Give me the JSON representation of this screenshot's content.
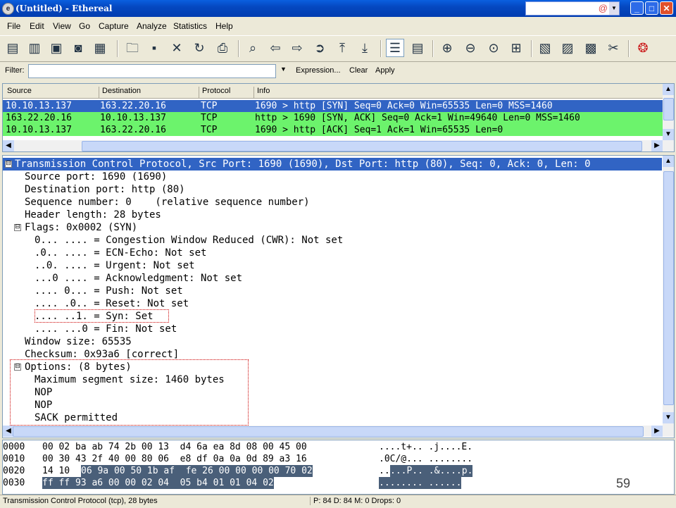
{
  "window": {
    "title": "(Untitled) - Ethereal"
  },
  "menu": [
    "File",
    "Edit",
    "View",
    "Go",
    "Capture",
    "Analyze",
    "Statistics",
    "Help"
  ],
  "filter": {
    "label": "Filter:",
    "value": "",
    "expression": "Expression...",
    "clear": "Clear",
    "apply": "Apply"
  },
  "packet_list": {
    "columns": [
      "Source",
      "Destination",
      "Protocol",
      "Info"
    ],
    "rows": [
      {
        "source": "10.10.13.137",
        "destination": "163.22.20.16",
        "protocol": "TCP",
        "info": "1690 > http [SYN] Seq=0 Ack=0 Win=65535 Len=0 MSS=1460",
        "selected": true
      },
      {
        "source": "163.22.20.16",
        "destination": "10.10.13.137",
        "protocol": "TCP",
        "info": "http > 1690 [SYN, ACK] Seq=0 Ack=1 Win=49640 Len=0 MSS=1460",
        "selected": false
      },
      {
        "source": "10.10.13.137",
        "destination": "163.22.20.16",
        "protocol": "TCP",
        "info": "1690 > http [ACK] Seq=1 Ack=1 Win=65535 Len=0",
        "selected": false
      }
    ]
  },
  "detail_tree": [
    {
      "text": "Transmission Control Protocol, Src Port: 1690 (1690), Dst Port: http (80), Seq: 0, Ack: 0, Len: 0",
      "depth": 0,
      "toggle": "⊟",
      "selected": true
    },
    {
      "text": "Source port: 1690 (1690)",
      "depth": 1
    },
    {
      "text": "Destination port: http (80)",
      "depth": 1
    },
    {
      "text": "Sequence number: 0    (relative sequence number)",
      "depth": 1
    },
    {
      "text": "Header length: 28 bytes",
      "depth": 1
    },
    {
      "text": "Flags: 0x0002 (SYN)",
      "depth": 1,
      "toggle": "⊟"
    },
    {
      "text": "0... .... = Congestion Window Reduced (CWR): Not set",
      "depth": 2
    },
    {
      "text": ".0.. .... = ECN-Echo: Not set",
      "depth": 2
    },
    {
      "text": "..0. .... = Urgent: Not set",
      "depth": 2
    },
    {
      "text": "...0 .... = Acknowledgment: Not set",
      "depth": 2
    },
    {
      "text": ".... 0... = Push: Not set",
      "depth": 2
    },
    {
      "text": ".... .0.. = Reset: Not set",
      "depth": 2
    },
    {
      "text": ".... ..1. = Syn: Set",
      "depth": 2
    },
    {
      "text": ".... ...0 = Fin: Not set",
      "depth": 2
    },
    {
      "text": "Window size: 65535",
      "depth": 1
    },
    {
      "text": "Checksum: 0x93a6 [correct]",
      "depth": 1
    },
    {
      "text": "Options: (8 bytes)",
      "depth": 1,
      "toggle": "⊟"
    },
    {
      "text": "Maximum segment size: 1460 bytes",
      "depth": 2
    },
    {
      "text": "NOP",
      "depth": 2
    },
    {
      "text": "NOP",
      "depth": 2
    },
    {
      "text": "SACK permitted",
      "depth": 2
    }
  ],
  "hex_dump": [
    {
      "offset": "0000",
      "bytes_plain": "00 02 ba ab 74 2b 00 13  d4 6a ea 8d 08 00 45 00",
      "bytes_hl": "",
      "ascii_plain": "....t+.. .j....E.",
      "ascii_hl": ""
    },
    {
      "offset": "0010",
      "bytes_plain": "00 30 43 2f 40 00 80 06  e8 df 0a 0a 0d 89 a3 16",
      "bytes_hl": "",
      "ascii_plain": ".0C/@... ........",
      "ascii_hl": ""
    },
    {
      "offset": "0020",
      "bytes_plain": "14 10 ",
      "bytes_hl": "06 9a 00 50 1b af  fe 26 00 00 00 00 70 02",
      "ascii_plain": "..",
      "ascii_hl": "...P.. .&....p."
    },
    {
      "offset": "0030",
      "bytes_plain": "",
      "bytes_hl": "ff ff 93 a6 00 00 02 04  05 b4 01 01 04 02",
      "ascii_plain": "",
      "ascii_hl": "........ ......"
    }
  ],
  "slide_number": "59",
  "status": {
    "left": "Transmission Control Protocol (tcp), 28 bytes",
    "right": "P: 84 D: 84 M: 0 Drops: 0"
  },
  "colors": {
    "selected": "#3164c4",
    "syn_ack_green": "#6cf36c",
    "hex_highlight": "#4a5f79",
    "annotation_red": "#c00000"
  }
}
